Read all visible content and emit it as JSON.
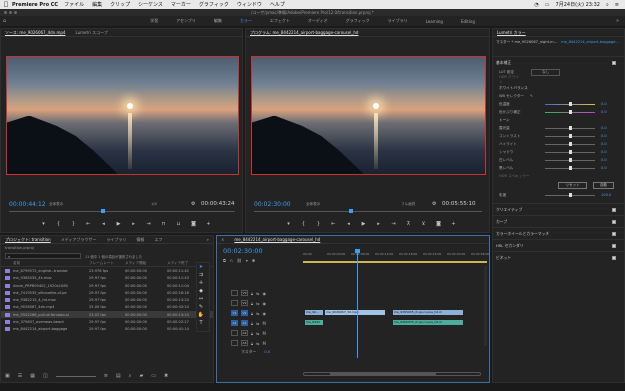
{
  "menubar": {
    "app_name": "Premiere Pro CC",
    "items": [
      "ファイル",
      "編集",
      "クリップ",
      "シーケンス",
      "マーカー",
      "グラフィック",
      "ウィンドウ",
      "ヘルプ"
    ],
    "clock": "7月24日(火) 23:32"
  },
  "titlebar": {
    "path": "/ユーザ/ymac/準備/Adobe/Premiere Pro/12.0/transition.prproj *"
  },
  "workspaces": {
    "tabs": [
      "学習",
      "アセンブリ",
      "編集",
      "カラー",
      "エフェクト",
      "オーディオ",
      "グラフィック",
      "ライブラリ",
      "Learning",
      "Editing"
    ],
    "active": "カラー"
  },
  "source": {
    "tab_label": "ソース: me_9026067_4dn.mp4",
    "tab2_label": "Lumetri スコープ",
    "timecode": "00:00:44:12",
    "fit": "全体表示",
    "ratio": "1/4",
    "duration": "00:00:43:24"
  },
  "program": {
    "tab_label": "プログラム: me_8442214_airport-baggage-carousel_hd",
    "timecode": "00:02:30:00",
    "fit": "全体表示",
    "quality": "フル画質",
    "duration": "00:05:55:10"
  },
  "lumetri": {
    "tab_label": "Lumetri カラー",
    "master_label": "マスター * me_9026067_night.m...",
    "seq_label": "me_8442214_airport-baggage...",
    "sections": {
      "basic": "基本補正",
      "creative": "クリエイティブ",
      "curves": "カーブ",
      "wheels": "カラーホイールとカラーマッチ",
      "hsl": "HSL セカンダリ",
      "vignette": "ビネット"
    },
    "lut_label": "LUT 設定",
    "lut_value": "なし",
    "hdr_label": "HDR ホワイト",
    "wb_header": "ホワイトバランス",
    "wb_selector": "WB セレクター",
    "temp": {
      "label": "色温度",
      "value": "0.0"
    },
    "tint": {
      "label": "色かぶり補正",
      "value": "0.0"
    },
    "tone_header": "トーン",
    "tone": [
      {
        "label": "露光量",
        "value": "0.0"
      },
      {
        "label": "コントラスト",
        "value": "0.0"
      },
      {
        "label": "ハイライト",
        "value": "0.0"
      },
      {
        "label": "シャドウ",
        "value": "0.0"
      },
      {
        "label": "白レベル",
        "value": "0.0"
      },
      {
        "label": "黒レベル",
        "value": "0.0"
      }
    ],
    "hdr_spec": "HDR スペキュラー",
    "reset_label": "リセット",
    "auto_label": "自動",
    "saturation": {
      "label": "彩度",
      "value": "100.0"
    }
  },
  "project": {
    "tab_label": "プロジェクト: transition",
    "other_tabs": [
      "メディアブラウザー",
      "ライブラリ",
      "情報",
      "エフ"
    ],
    "file_name": "transition.prproj",
    "selection_info": "11 個中 1 個の項目が選択されました",
    "columns": [
      "名前",
      "フレームレート",
      "メディア開始",
      "メディア終了"
    ],
    "rows": [
      {
        "name": "me_8799572_english--translat",
        "fps": "23.976 fps",
        "start": "00:00:00:00",
        "end": "00:00:11:42"
      },
      {
        "name": "me_9365035_4k.mov",
        "fps": "29.97 fps",
        "start": "00:00:00:00",
        "end": "00:00:11:43"
      },
      {
        "name": "Alone_PRPR05402_1920x1080",
        "fps": "29.97 fps",
        "start": "00:00:00:00",
        "end": "00:00:11:04"
      },
      {
        "name": "me_7419535_silhouette-of-pe",
        "fps": "29.97 fps",
        "start": "00:00:00:00",
        "end": "00:00:16:16"
      },
      {
        "name": "me_9382215_4_hd.mov",
        "fps": "29.97 fps",
        "start": "00:00:00:00",
        "end": "00:00:13:24"
      },
      {
        "name": "me_9026067_4dn.mp4",
        "fps": "25.00 fps",
        "start": "00:00:00:00",
        "end": "00:00:43:24"
      },
      {
        "name": "me_5502266_pull-of-fernado-si",
        "fps": "23.02 fps",
        "start": "00:00:00:00",
        "end": "00:00:13:24"
      },
      {
        "name": "me_375637_overseas-beach",
        "fps": "29.97 fps",
        "start": "00:00:00:00",
        "end": "00:00:22:27"
      },
      {
        "name": "me_8442214_airport-baggage",
        "fps": "29.97 fps",
        "start": "00:00:00:00",
        "end": "00:00:41:14"
      }
    ]
  },
  "timeline": {
    "tab_label": "me_8442214_airport-baggage-carousel_hd",
    "timecode": "00:02:30:00",
    "ruler": [
      "00:00",
      "00:02:00:00",
      "00:02:06:00",
      "00:02:12:00",
      "00:02:18:00",
      "00:02:24:00",
      "00:02:30:00",
      "00:02:36:00"
    ],
    "tracks": [
      "V3",
      "V2",
      "V1",
      "A1",
      "A2",
      "A3"
    ],
    "master_label": "マスター",
    "master_value": "0.0",
    "clips": {
      "v1a": "me_90...",
      "v1b": "me_9026067_3d.mp4",
      "v1c": "me_9365035_ih.go.ro.pue_hd.m",
      "a1a": "me_8442",
      "a1b": "me_9365035_ih.go.ro.pue_hd.m"
    }
  },
  "colors": {
    "accent": "#3d9ef5",
    "playhead": "#3d9ef5",
    "frame_red": "#d0302b",
    "clip_video": "#8db0d7",
    "clip_audio": "#4cae9a"
  }
}
